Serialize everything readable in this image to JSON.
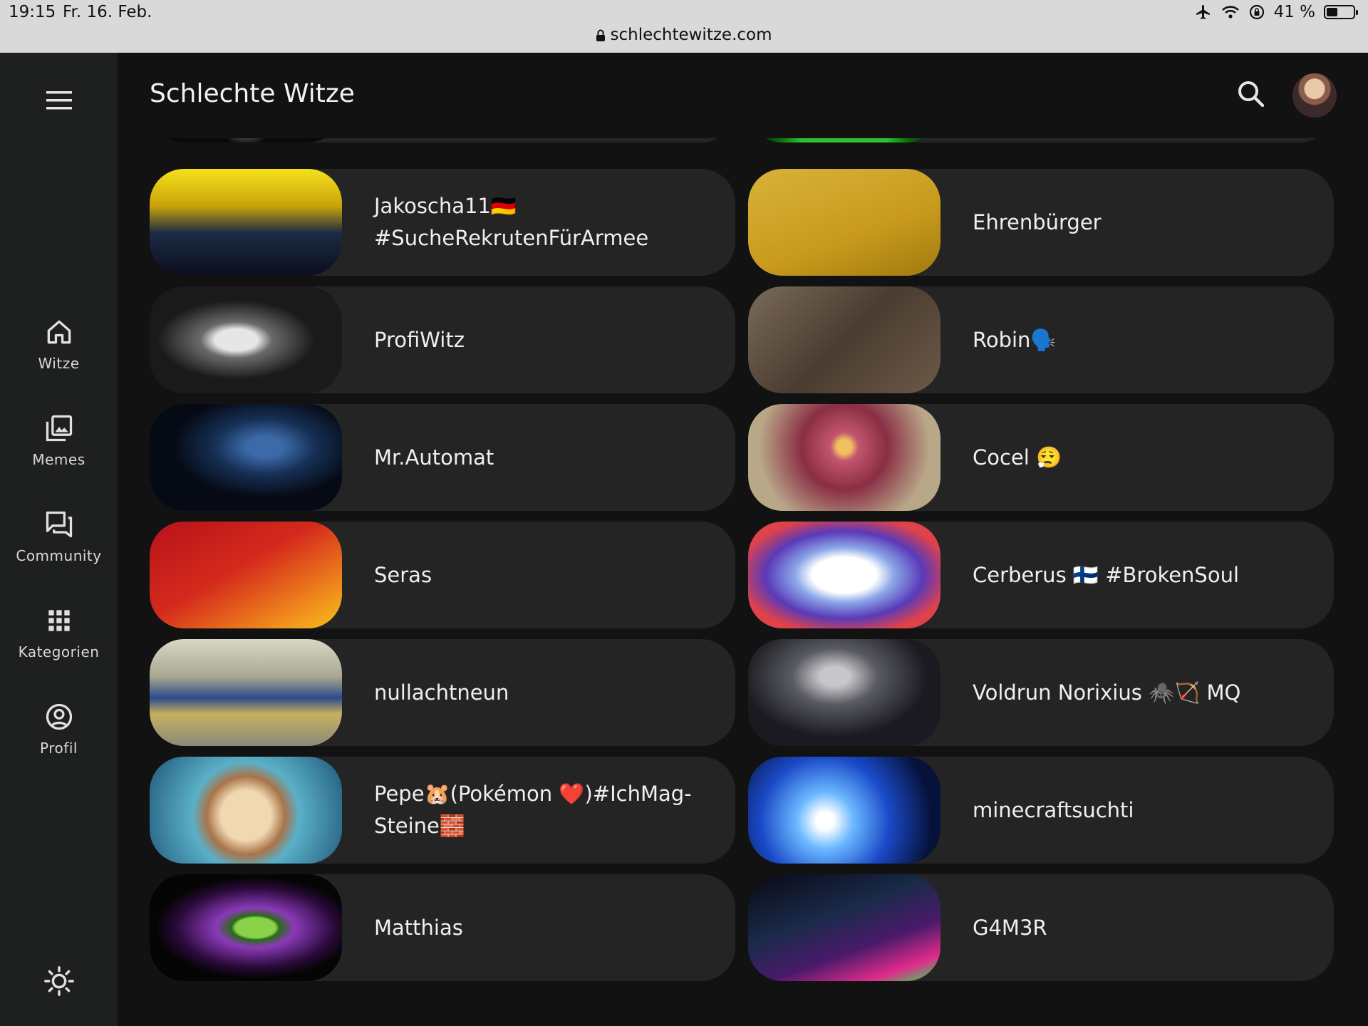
{
  "status_bar": {
    "time": "19:15",
    "date": "Fr. 16. Feb.",
    "url": "schlechtewitze.com",
    "battery": "41 %",
    "battery_level": 0.41
  },
  "app": {
    "title": "Schlechte Witze"
  },
  "rail": {
    "items": [
      {
        "label": "Witze",
        "icon": "home-icon"
      },
      {
        "label": "Memes",
        "icon": "image-library-icon"
      },
      {
        "label": "Community",
        "icon": "forum-icon"
      },
      {
        "label": "Kategorien",
        "icon": "apps-grid-icon"
      },
      {
        "label": "Profil",
        "icon": "account-circle-icon"
      }
    ],
    "theme_icon": "brightness-icon"
  },
  "users": [
    {
      "name": "",
      "partial": true
    },
    {
      "name": "",
      "partial": true
    },
    {
      "name": "Jakoscha11🇩🇪 #SucheRekrutenFürArmee"
    },
    {
      "name": "Ehrenbürger"
    },
    {
      "name": "ProfiWitz"
    },
    {
      "name": "Robin🗣️"
    },
    {
      "name": "Mr.Automat"
    },
    {
      "name": "Cocel 😮‍💨"
    },
    {
      "name": "Seras"
    },
    {
      "name": "Cerberus 🇫🇮 #BrokenSoul"
    },
    {
      "name": "nullachtneun"
    },
    {
      "name": "Voldrun Norixius 🕷️🏹 MQ"
    },
    {
      "name": "Pepe🐹(Pokémon ❤️)#IchMag-Steine🧱"
    },
    {
      "name": "minecraftsuchti"
    },
    {
      "name": "Matthias"
    },
    {
      "name": "G4M3R"
    }
  ],
  "colors": {
    "background": "#121212",
    "rail": "#1e1f1f",
    "card": "#242424",
    "status_bar": "#d9d9d9"
  }
}
